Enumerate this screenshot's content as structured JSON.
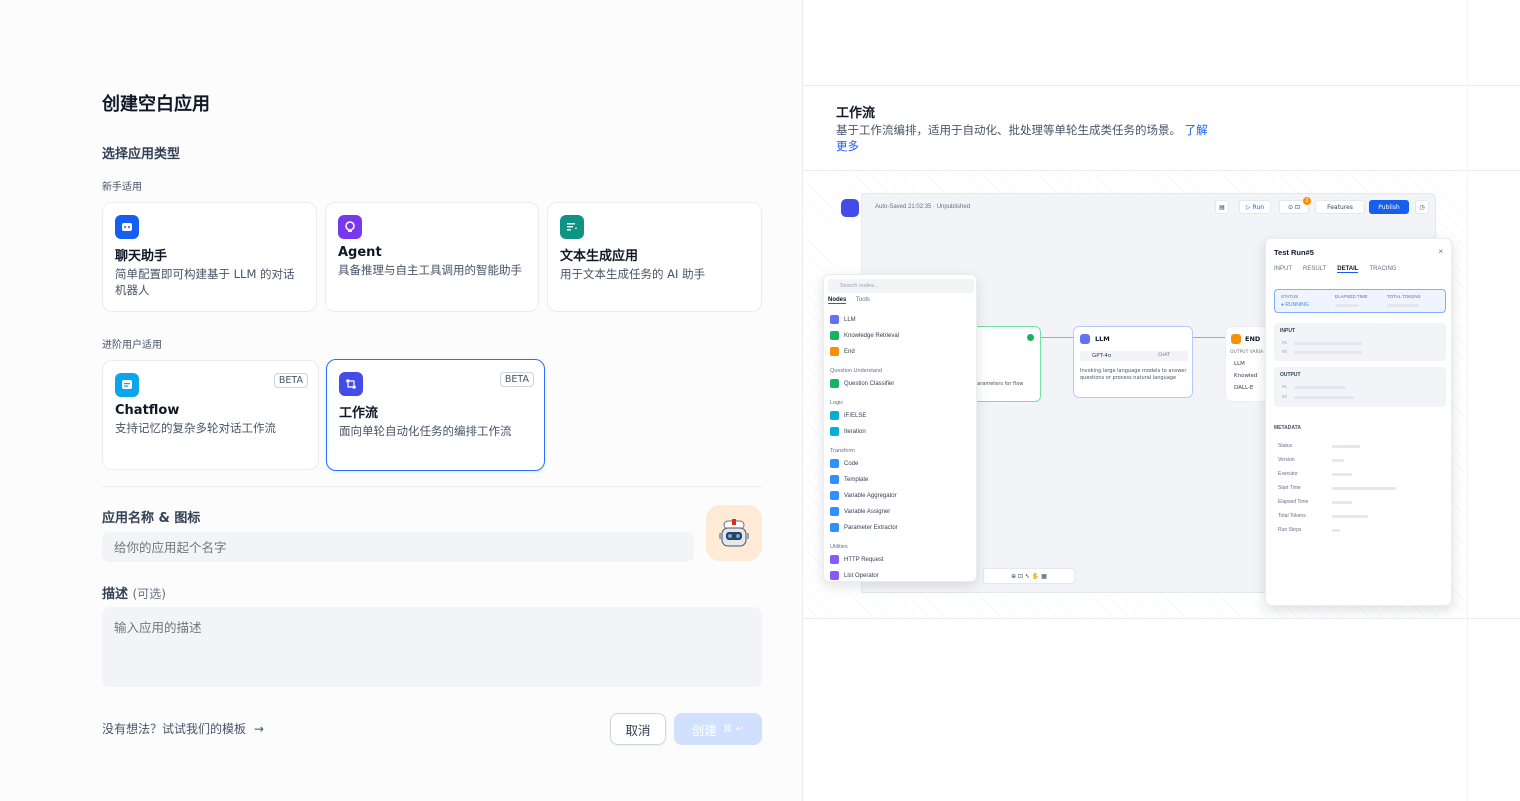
{
  "dialog": {
    "title": "创建空白应用",
    "choose_type_label": "选择应用类型",
    "beginner_label": "新手适用",
    "advanced_label": "进阶用户适用",
    "beginner_cards": [
      {
        "title": "聊天助手",
        "desc": "简单配置即可构建基于 LLM 的对话机器人",
        "icon": "chat-bot-icon",
        "color": "#155eef"
      },
      {
        "title": "Agent",
        "desc": "具备推理与自主工具调用的智能助手",
        "icon": "agent-icon",
        "color": "#7839ee"
      },
      {
        "title": "文本生成应用",
        "desc": "用于文本生成任务的 AI 助手",
        "icon": "text-generation-icon",
        "color": "#0e9384"
      }
    ],
    "advanced_cards": [
      {
        "title": "Chatflow",
        "desc": "支持记忆的复杂多轮对话工作流",
        "badge": "BETA",
        "icon": "chatflow-icon",
        "color": "#0ba5ec"
      },
      {
        "title": "工作流",
        "desc": "面向单轮自动化任务的编排工作流",
        "badge": "BETA",
        "icon": "workflow-icon",
        "color": "#444ce7",
        "selected": true
      }
    ],
    "name_icon_label": "应用名称 & 图标",
    "name_placeholder": "给你的应用起个名字",
    "desc_label": "描述",
    "desc_optional": "(可选)",
    "desc_placeholder": "输入应用的描述",
    "template_link": "没有想法？试试我们的模板",
    "cancel_label": "取消",
    "create_label": "创建",
    "create_shortcut": "⌘ ↵"
  },
  "preview": {
    "title": "工作流",
    "desc": "基于工作流编排，适用于自动化、批处理等单轮生成类任务的场景。",
    "learn_more": "了解更多",
    "mock": {
      "autosave": "Auto-Saved 21:02:35 · Unpublished",
      "run": "Run",
      "features": "Features",
      "publish": "Publish",
      "badge_count": "2",
      "search_placeholder": "Search nodes...",
      "tab_nodes": "Nodes",
      "tab_tools": "Tools",
      "groups": [
        {
          "label": "",
          "items": [
            {
              "name": "LLM",
              "color": "#6172f3"
            },
            {
              "name": "Knowledge Retrieval",
              "color": "#16b364"
            },
            {
              "name": "End",
              "color": "#f79009"
            }
          ]
        },
        {
          "label": "Question Understand",
          "items": [
            {
              "name": "Question Classifier",
              "color": "#16b364"
            }
          ]
        },
        {
          "label": "Logic",
          "items": [
            {
              "name": "IF/ELSE",
              "color": "#06aed4"
            },
            {
              "name": "Iteration",
              "color": "#06aed4"
            }
          ]
        },
        {
          "label": "Transform",
          "items": [
            {
              "name": "Code",
              "color": "#2e90fa"
            },
            {
              "name": "Template",
              "color": "#2e90fa"
            },
            {
              "name": "Variable Aggregator",
              "color": "#2e90fa"
            },
            {
              "name": "Variable Assigner",
              "color": "#2e90fa"
            },
            {
              "name": "Parameter Extractor",
              "color": "#2e90fa"
            }
          ]
        },
        {
          "label": "Utilities",
          "items": [
            {
              "name": "HTTP Request",
              "color": "#875bf7"
            },
            {
              "name": "List Operator",
              "color": "#875bf7"
            }
          ]
        }
      ],
      "llm_node": {
        "title": "LLM",
        "model": "GPT-4o",
        "mode": "CHAT",
        "desc": "Invoking large language models to answer questions or process natural language"
      },
      "start_node_desc": "parameters for flow",
      "end_node": {
        "title": "END",
        "output": "OUTPUT VARIA",
        "rows": [
          "LLM",
          "Knowled",
          "DALL-E"
        ]
      },
      "test_run": {
        "title": "Test Run#5",
        "tabs": [
          "INPUT",
          "RESULT",
          "DETAIL",
          "TRACING"
        ],
        "active_tab": "DETAIL",
        "status_label": "STATUS",
        "status_value": "RUNNING",
        "elapsed_label": "ELAPSED TIME",
        "tokens_label": "TOTAL TOKENS",
        "input_label": "INPUT",
        "output_label": "OUTPUT",
        "row1": "#1",
        "row2": "#2",
        "metadata_label": "METADATA",
        "metadata": [
          "Status",
          "Version",
          "Executor",
          "Start Time",
          "Elapsed Time",
          "Total Tokens",
          "Run Steps"
        ]
      }
    }
  }
}
